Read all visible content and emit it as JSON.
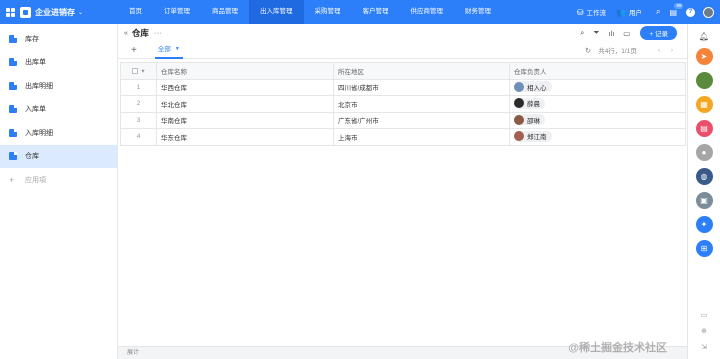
{
  "app": {
    "title": "企业进销存"
  },
  "nav": [
    {
      "label": "首页"
    },
    {
      "label": "订单管理"
    },
    {
      "label": "商品管理"
    },
    {
      "label": "出入库管理"
    },
    {
      "label": "采购管理"
    },
    {
      "label": "客户管理"
    },
    {
      "label": "供应商管理"
    },
    {
      "label": "财务管理"
    }
  ],
  "topright": {
    "workflow": "工作流",
    "users": "用户",
    "badge": "99"
  },
  "sidebar": {
    "items": [
      {
        "label": "库存"
      },
      {
        "label": "出库单"
      },
      {
        "label": "出库明细"
      },
      {
        "label": "入库单"
      },
      {
        "label": "入库明细"
      },
      {
        "label": "仓库"
      }
    ],
    "add_label": "应用項"
  },
  "view": {
    "title": "仓库",
    "add_record": "+ 记录",
    "tab_all": "全部",
    "count": "共4行，1/1页"
  },
  "table": {
    "headers": [
      "仓库名称",
      "所在地区",
      "仓库负责人"
    ],
    "rows": [
      {
        "no": "1",
        "name": "华西仓库",
        "region": "四川省/成都市",
        "owner": "相入心",
        "owner_color": "#6d8fb8"
      },
      {
        "no": "2",
        "name": "华北仓库",
        "region": "北京市",
        "owner": "薛晨",
        "owner_color": "#2b2b2b"
      },
      {
        "no": "3",
        "name": "华南仓库",
        "region": "广东省/广州市",
        "owner": "邵琳",
        "owner_color": "#8a5a44"
      },
      {
        "no": "4",
        "name": "华东仓库",
        "region": "上海市",
        "owner": "郑江南",
        "owner_color": "#a35e4f"
      }
    ]
  },
  "footer": {
    "label": "展计"
  },
  "watermark": "@稀土掘金技术社区",
  "colors": {
    "primary": "#2d7ff9",
    "active_nav": "#1f6ae0",
    "active_side": "#dbeafe"
  }
}
